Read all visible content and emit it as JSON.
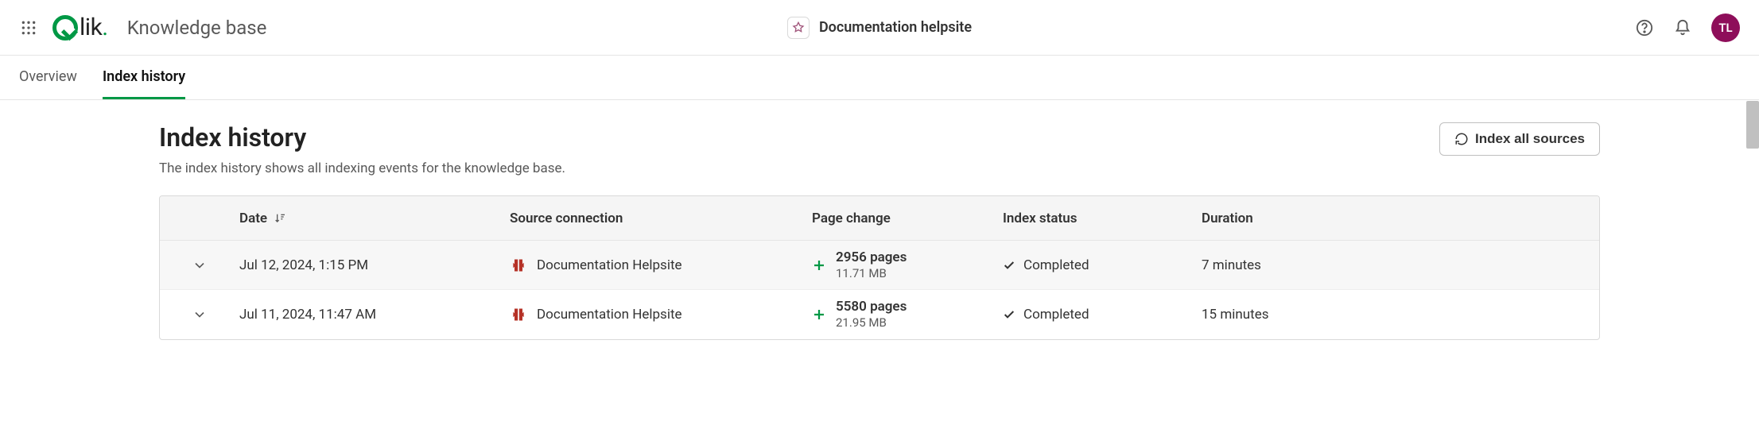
{
  "header": {
    "breadcrumb": "Knowledge base",
    "center_label": "Documentation helpsite",
    "avatar_initials": "TL"
  },
  "tabs": [
    {
      "label": "Overview",
      "active": false
    },
    {
      "label": "Index history",
      "active": true
    }
  ],
  "page": {
    "title": "Index history",
    "subtitle": "The index history shows all indexing events for the knowledge base.",
    "index_button": "Index all sources"
  },
  "table": {
    "columns": {
      "date": "Date",
      "source": "Source connection",
      "page_change": "Page change",
      "status": "Index status",
      "duration": "Duration"
    },
    "rows": [
      {
        "date": "Jul 12, 2024, 1:15 PM",
        "source": "Documentation Helpsite",
        "pages": "2956 pages",
        "size": "11.71 MB",
        "status": "Completed",
        "duration": "7 minutes"
      },
      {
        "date": "Jul 11, 2024, 11:47 AM",
        "source": "Documentation Helpsite",
        "pages": "5580 pages",
        "size": "21.95 MB",
        "status": "Completed",
        "duration": "15 minutes"
      }
    ]
  }
}
